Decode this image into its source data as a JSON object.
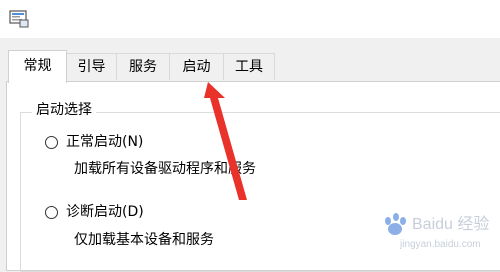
{
  "tabs": [
    {
      "label": "常规",
      "active": true
    },
    {
      "label": "引导"
    },
    {
      "label": "服务"
    },
    {
      "label": "启动"
    },
    {
      "label": "工具"
    }
  ],
  "group": {
    "title": "启动选择"
  },
  "options": [
    {
      "label": "正常启动(N)",
      "description": "加载所有设备驱动程序和服务"
    },
    {
      "label": "诊断启动(D)",
      "description": "仅加载基本设备和服务"
    }
  ],
  "watermark": {
    "text": "Baidu 经验",
    "subtext": "jingyan.baidu.com"
  },
  "colors": {
    "annotation_arrow": "#e8322a",
    "watermark_blue": "#2f6fd6"
  }
}
